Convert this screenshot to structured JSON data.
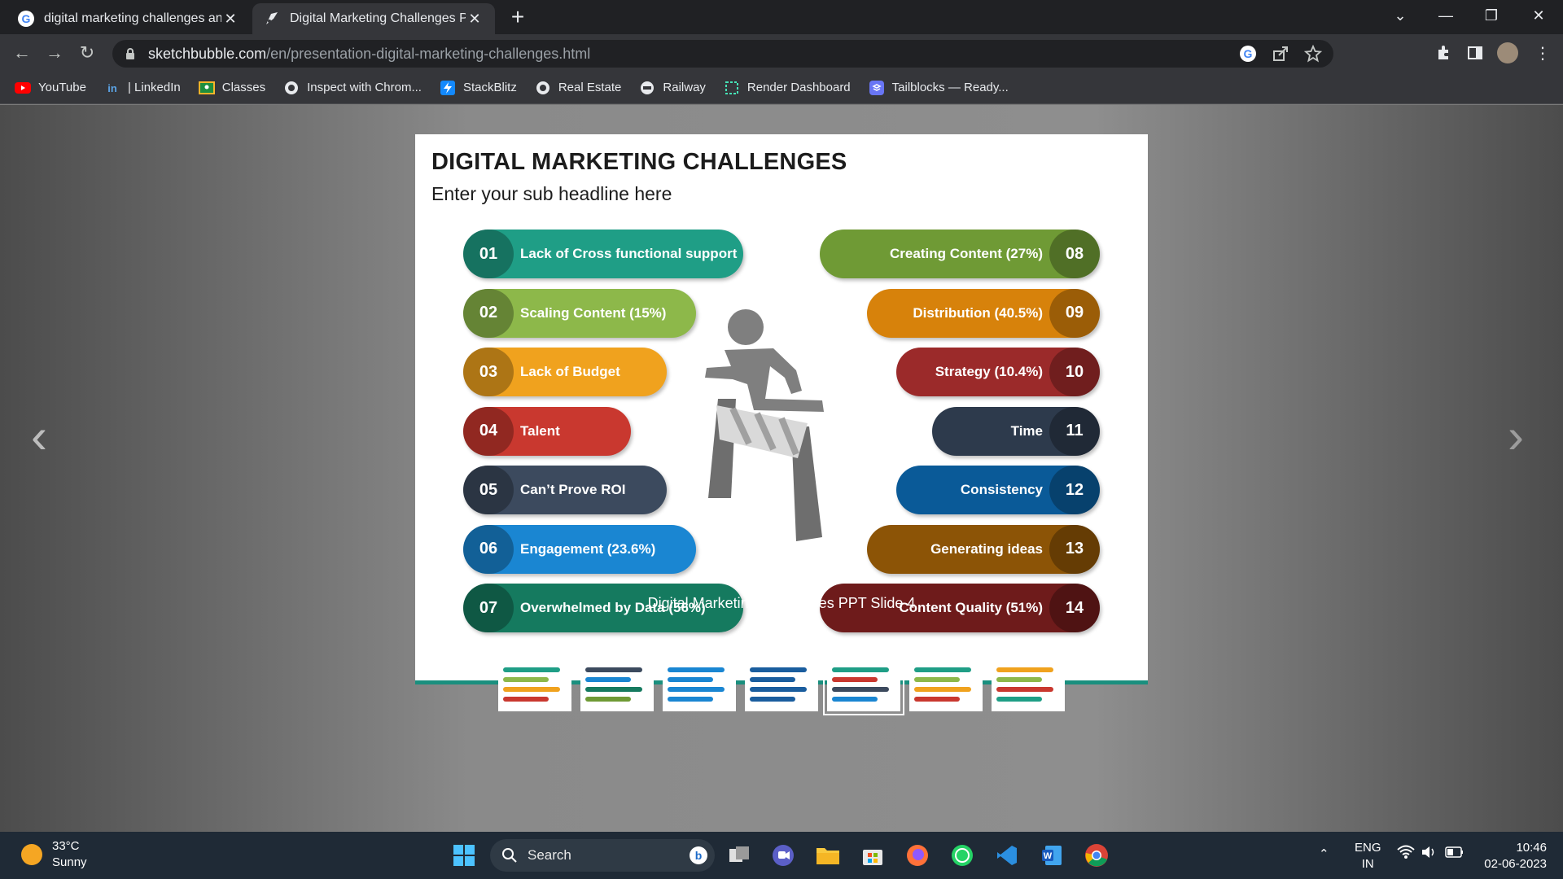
{
  "browser": {
    "tabs": [
      {
        "title": "digital marketing challenges and",
        "active": false,
        "icon": "google-icon"
      },
      {
        "title": "Digital Marketing Challenges Pov",
        "active": true,
        "icon": "sketchbubble-icon"
      }
    ],
    "url_host": "sketchbubble.com",
    "url_path": "/en/presentation-digital-marketing-challenges.html",
    "bookmarks": [
      {
        "label": "YouTube",
        "icon": "youtube-icon"
      },
      {
        "label": "| LinkedIn",
        "icon": "linkedin-icon"
      },
      {
        "label": "Classes",
        "icon": "classroom-icon"
      },
      {
        "label": "Inspect with Chrom...",
        "icon": "globe-icon"
      },
      {
        "label": "StackBlitz",
        "icon": "stackblitz-icon"
      },
      {
        "label": "Real Estate",
        "icon": "globe-icon"
      },
      {
        "label": "Railway",
        "icon": "railway-icon"
      },
      {
        "label": "Render Dashboard",
        "icon": "render-icon"
      },
      {
        "label": "Tailblocks — Ready...",
        "icon": "tailblocks-icon"
      }
    ]
  },
  "slide": {
    "title": "DIGITAL MARKETING CHALLENGES",
    "subtitle": "Enter your sub headline here",
    "left_items": [
      {
        "num": "01",
        "label": "Lack of Cross functional support",
        "color": "#1f9e86"
      },
      {
        "num": "02",
        "label": "Scaling Content (15%)",
        "color": "#8db84a"
      },
      {
        "num": "03",
        "label": "Lack of Budget",
        "color": "#f0a21e"
      },
      {
        "num": "04",
        "label": "Talent",
        "color": "#c9382f"
      },
      {
        "num": "05",
        "label": "Can’t Prove ROI",
        "color": "#3c4a5e"
      },
      {
        "num": "06",
        "label": "Engagement (23.6%)",
        "color": "#1a86d2"
      },
      {
        "num": "07",
        "label": "Overwhelmed by Data (56%)",
        "color": "#157a5f"
      }
    ],
    "right_items": [
      {
        "num": "08",
        "label": "Creating Content (27%)",
        "color": "#6f9a35"
      },
      {
        "num": "09",
        "label": "Distribution (40.5%)",
        "color": "#d7820b"
      },
      {
        "num": "10",
        "label": "Strategy (10.4%)",
        "color": "#9b2a2a"
      },
      {
        "num": "11",
        "label": "Time",
        "color": "#2d3a4c"
      },
      {
        "num": "12",
        "label": "Consistency",
        "color": "#0a5a98"
      },
      {
        "num": "13",
        "label": "Generating ideas",
        "color": "#8c5406"
      },
      {
        "num": "14",
        "label": "Content Quality (51%)",
        "color": "#6e1b1b"
      }
    ]
  },
  "caption": "Digital Marketing Challenges PPT Slide 4",
  "taskbar": {
    "temperature": "33°C",
    "condition": "Sunny",
    "search_label": "Search",
    "lang": "ENG",
    "region": "IN",
    "time": "10:46",
    "date": "02-06-2023"
  }
}
